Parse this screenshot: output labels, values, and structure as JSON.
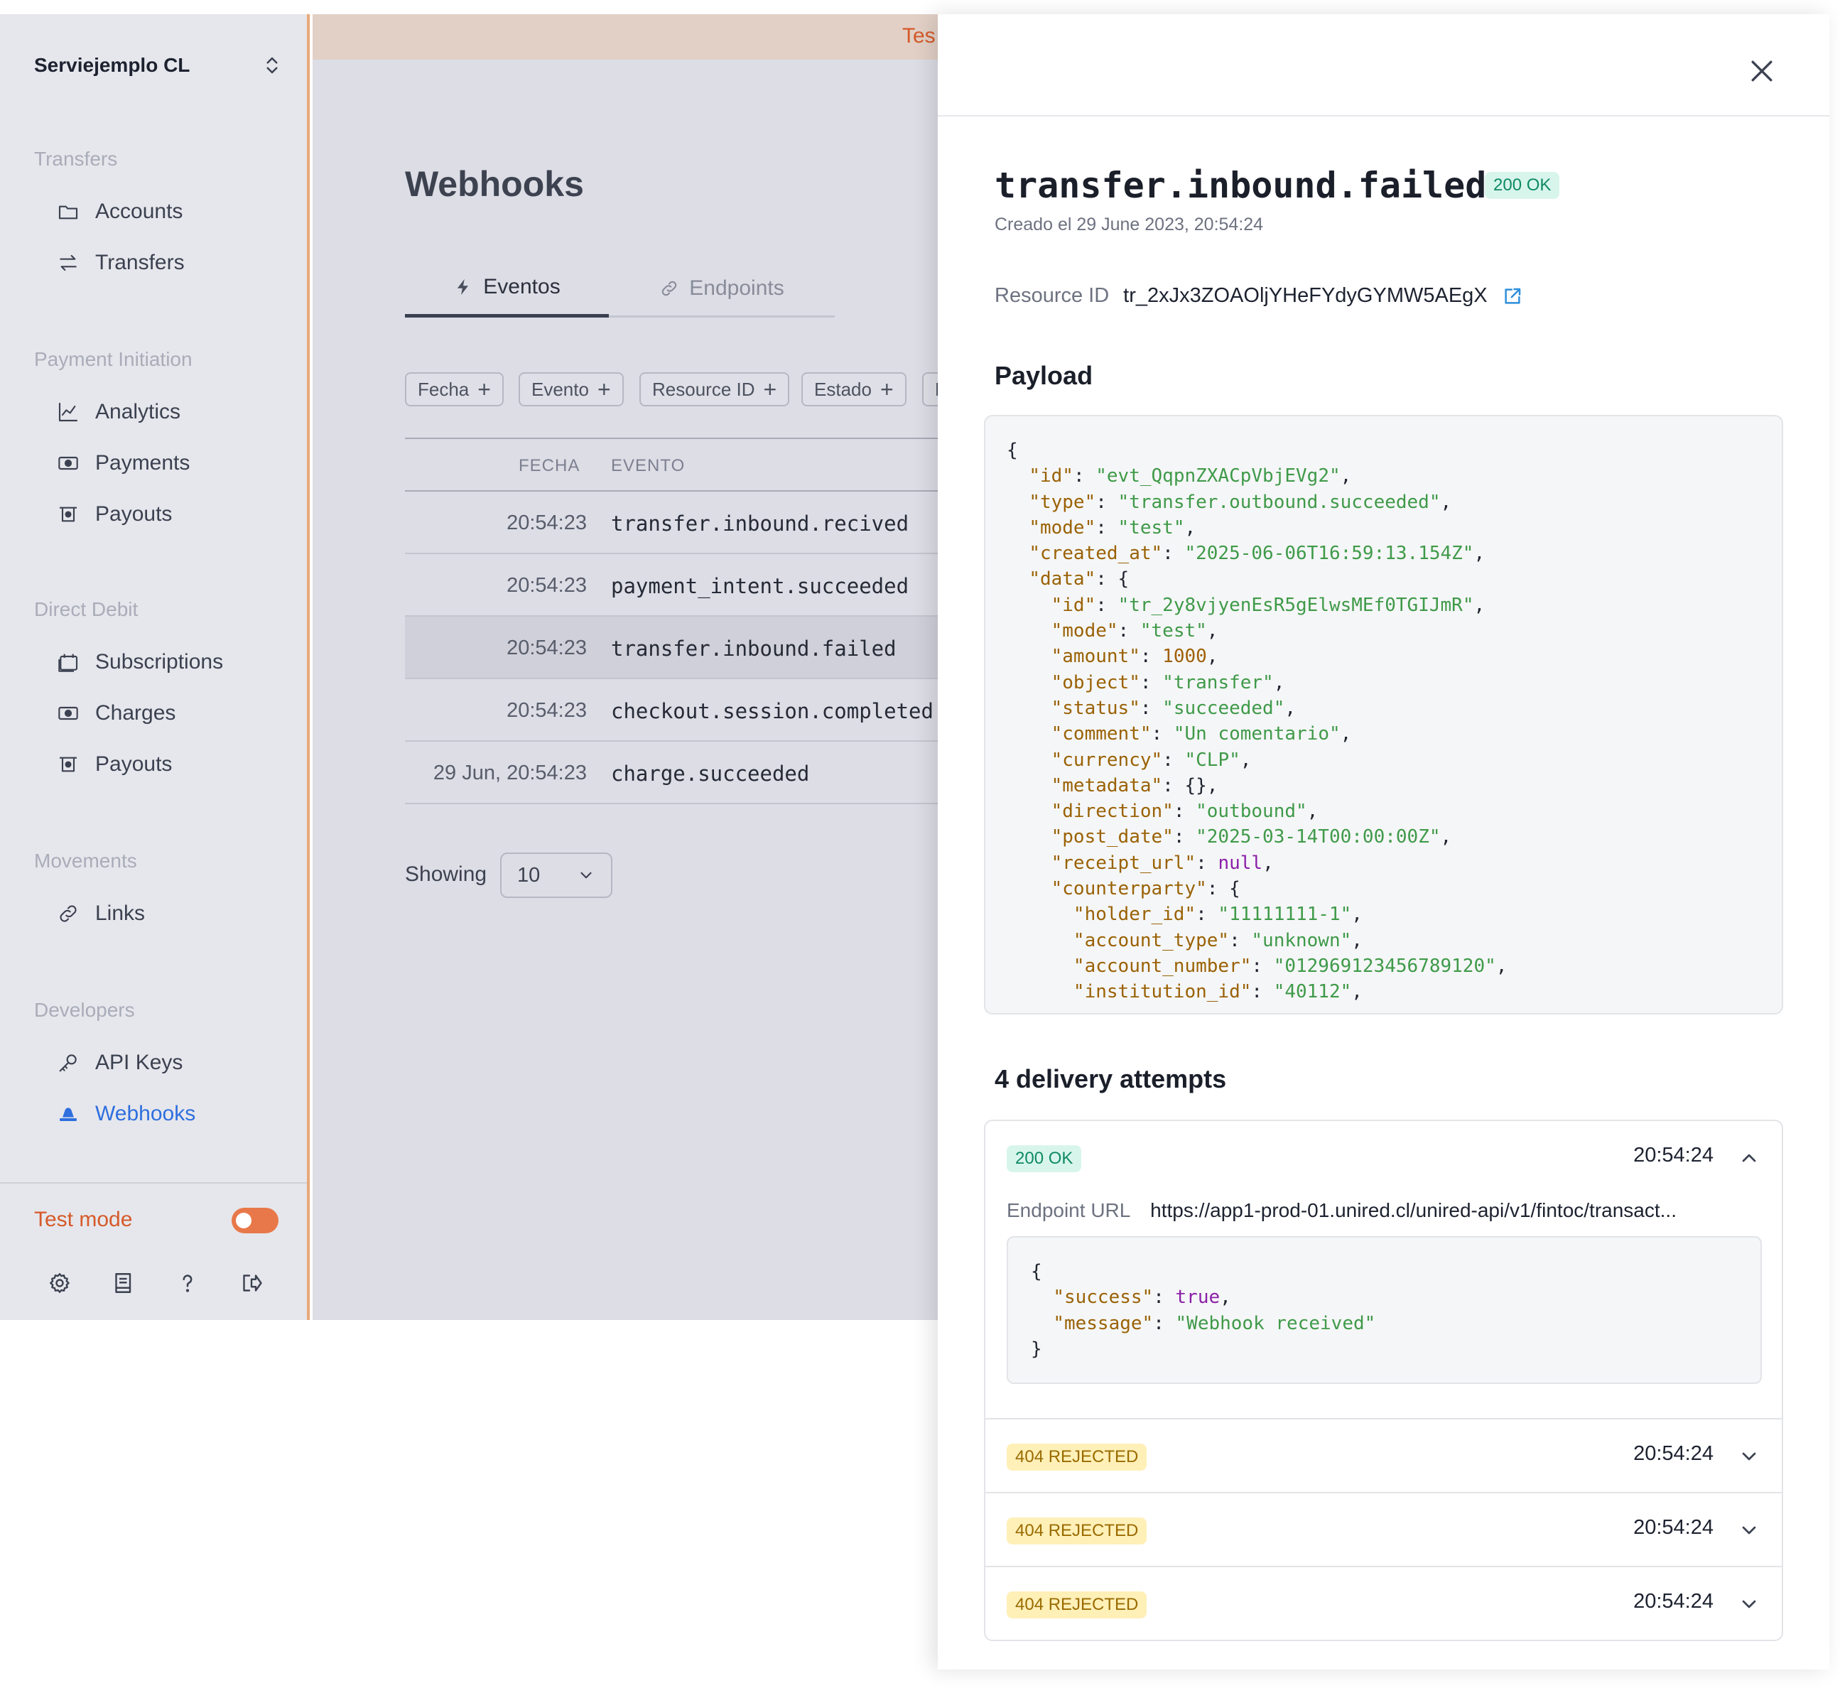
{
  "sidebar": {
    "org_name": "Serviejemplo CL",
    "sections": [
      {
        "title": "Transfers",
        "items": [
          {
            "label": "Accounts",
            "icon": "folder-icon"
          },
          {
            "label": "Transfers",
            "icon": "arrows-swap-icon"
          }
        ]
      },
      {
        "title": "Payment Initiation",
        "items": [
          {
            "label": "Analytics",
            "icon": "chart-line-icon"
          },
          {
            "label": "Payments",
            "icon": "cash-icon"
          },
          {
            "label": "Payouts",
            "icon": "payout-icon"
          }
        ]
      },
      {
        "title": "Direct Debit",
        "items": [
          {
            "label": "Subscriptions",
            "icon": "calendar-icon"
          },
          {
            "label": "Charges",
            "icon": "cash-icon"
          },
          {
            "label": "Payouts",
            "icon": "payout-icon"
          }
        ]
      },
      {
        "title": "Movements",
        "items": [
          {
            "label": "Links",
            "icon": "link-icon"
          }
        ]
      },
      {
        "title": "Developers",
        "items": [
          {
            "label": "API Keys",
            "icon": "key-icon"
          },
          {
            "label": "Webhooks",
            "icon": "webhook-icon",
            "active": true
          }
        ]
      }
    ],
    "test_mode_label": "Test mode",
    "test_mode_on": true,
    "footer_icons": [
      "settings-icon",
      "docs-icon",
      "help-icon",
      "logout-icon"
    ]
  },
  "banner": {
    "text": "Tes"
  },
  "main": {
    "title": "Webhooks",
    "tabs": [
      {
        "label": "Eventos",
        "icon": "bolt-icon",
        "active": true
      },
      {
        "label": "Endpoints",
        "icon": "link-icon",
        "active": false
      }
    ],
    "filters": [
      "Fecha",
      "Evento",
      "Resource ID",
      "Estado",
      "E"
    ],
    "table": {
      "headers": [
        "FECHA",
        "EVENTO"
      ],
      "rows": [
        {
          "date": "20:54:23",
          "event": "transfer.inbound.recived"
        },
        {
          "date": "20:54:23",
          "event": "payment_intent.succeeded"
        },
        {
          "date": "20:54:23",
          "event": "transfer.inbound.failed",
          "selected": true
        },
        {
          "date": "20:54:23",
          "event": "checkout.session.completed"
        },
        {
          "date": "29 Jun, 20:54:23",
          "event": "charge.succeeded"
        }
      ]
    },
    "showing_label": "Showing",
    "page_size": "10"
  },
  "drawer": {
    "event_type": "transfer.inbound.failed",
    "status_badge": "200 OK",
    "created_at": "Creado el 29 June 2023, 20:54:24",
    "resource_id_label": "Resource ID",
    "resource_id": "tr_2xJx3ZOAOljYHeFYdyGYMW5AEgX",
    "payload_title": "Payload",
    "payload_lines": [
      [
        [
          "p",
          "{"
        ]
      ],
      [
        [
          "p",
          "  "
        ],
        [
          "k",
          "\"id\""
        ],
        [
          "p",
          ": "
        ],
        [
          "s",
          "\"evt_QqpnZXACpVbjEVg2\""
        ],
        [
          "p",
          ","
        ]
      ],
      [
        [
          "p",
          "  "
        ],
        [
          "k",
          "\"type\""
        ],
        [
          "p",
          ": "
        ],
        [
          "s",
          "\"transfer.outbound.succeeded\""
        ],
        [
          "p",
          ","
        ]
      ],
      [
        [
          "p",
          "  "
        ],
        [
          "k",
          "\"mode\""
        ],
        [
          "p",
          ": "
        ],
        [
          "s",
          "\"test\""
        ],
        [
          "p",
          ","
        ]
      ],
      [
        [
          "p",
          "  "
        ],
        [
          "k",
          "\"created_at\""
        ],
        [
          "p",
          ": "
        ],
        [
          "s",
          "\"2025-06-06T16:59:13.154Z\""
        ],
        [
          "p",
          ","
        ]
      ],
      [
        [
          "p",
          "  "
        ],
        [
          "k",
          "\"data\""
        ],
        [
          "p",
          ": {"
        ]
      ],
      [
        [
          "p",
          "    "
        ],
        [
          "k",
          "\"id\""
        ],
        [
          "p",
          ": "
        ],
        [
          "s",
          "\"tr_2y8vjyenEsR5gElwsMEf0TGIJmR\""
        ],
        [
          "p",
          ","
        ]
      ],
      [
        [
          "p",
          "    "
        ],
        [
          "k",
          "\"mode\""
        ],
        [
          "p",
          ": "
        ],
        [
          "s",
          "\"test\""
        ],
        [
          "p",
          ","
        ]
      ],
      [
        [
          "p",
          "    "
        ],
        [
          "k",
          "\"amount\""
        ],
        [
          "p",
          ": "
        ],
        [
          "n",
          "1000"
        ],
        [
          "p",
          ","
        ]
      ],
      [
        [
          "p",
          "    "
        ],
        [
          "k",
          "\"object\""
        ],
        [
          "p",
          ": "
        ],
        [
          "s",
          "\"transfer\""
        ],
        [
          "p",
          ","
        ]
      ],
      [
        [
          "p",
          "    "
        ],
        [
          "k",
          "\"status\""
        ],
        [
          "p",
          ": "
        ],
        [
          "s",
          "\"succeeded\""
        ],
        [
          "p",
          ","
        ]
      ],
      [
        [
          "p",
          "    "
        ],
        [
          "k",
          "\"comment\""
        ],
        [
          "p",
          ": "
        ],
        [
          "s",
          "\"Un comentario\""
        ],
        [
          "p",
          ","
        ]
      ],
      [
        [
          "p",
          "    "
        ],
        [
          "k",
          "\"currency\""
        ],
        [
          "p",
          ": "
        ],
        [
          "s",
          "\"CLP\""
        ],
        [
          "p",
          ","
        ]
      ],
      [
        [
          "p",
          "    "
        ],
        [
          "k",
          "\"metadata\""
        ],
        [
          "p",
          ": {},"
        ]
      ],
      [
        [
          "p",
          "    "
        ],
        [
          "k",
          "\"direction\""
        ],
        [
          "p",
          ": "
        ],
        [
          "s",
          "\"outbound\""
        ],
        [
          "p",
          ","
        ]
      ],
      [
        [
          "p",
          "    "
        ],
        [
          "k",
          "\"post_date\""
        ],
        [
          "p",
          ": "
        ],
        [
          "s",
          "\"2025-03-14T00:00:00Z\""
        ],
        [
          "p",
          ","
        ]
      ],
      [
        [
          "p",
          "    "
        ],
        [
          "k",
          "\"receipt_url\""
        ],
        [
          "p",
          ": "
        ],
        [
          "l",
          "null"
        ],
        [
          "p",
          ","
        ]
      ],
      [
        [
          "p",
          "    "
        ],
        [
          "k",
          "\"counterparty\""
        ],
        [
          "p",
          ": {"
        ]
      ],
      [
        [
          "p",
          "      "
        ],
        [
          "k",
          "\"holder_id\""
        ],
        [
          "p",
          ": "
        ],
        [
          "s",
          "\"11111111-1\""
        ],
        [
          "p",
          ","
        ]
      ],
      [
        [
          "p",
          "      "
        ],
        [
          "k",
          "\"account_type\""
        ],
        [
          "p",
          ": "
        ],
        [
          "s",
          "\"unknown\""
        ],
        [
          "p",
          ","
        ]
      ],
      [
        [
          "p",
          "      "
        ],
        [
          "k",
          "\"account_number\""
        ],
        [
          "p",
          ": "
        ],
        [
          "s",
          "\"012969123456789120\""
        ],
        [
          "p",
          ","
        ]
      ],
      [
        [
          "p",
          "      "
        ],
        [
          "k",
          "\"institution_id\""
        ],
        [
          "p",
          ": "
        ],
        [
          "s",
          "\"40112\""
        ],
        [
          "p",
          ","
        ]
      ]
    ],
    "attempts_title": "4 delivery attempts",
    "attempts": [
      {
        "status": "200 OK",
        "kind": "ok",
        "time": "20:54:24",
        "expanded": true
      },
      {
        "status": "404 REJECTED",
        "kind": "rejected",
        "time": "20:54:24",
        "expanded": false
      },
      {
        "status": "404 REJECTED",
        "kind": "rejected",
        "time": "20:54:24",
        "expanded": false
      },
      {
        "status": "404 REJECTED",
        "kind": "rejected",
        "time": "20:54:24",
        "expanded": false
      }
    ],
    "endpoint_label": "Endpoint URL",
    "endpoint_url": "https://app1-prod-01.unired.cl/unired-api/v1/fintoc/transact...",
    "response_lines": [
      [
        [
          "p",
          "{"
        ]
      ],
      [
        [
          "p",
          "  "
        ],
        [
          "k",
          "\"success\""
        ],
        [
          "p",
          ": "
        ],
        [
          "l",
          "true"
        ],
        [
          "p",
          ","
        ]
      ],
      [
        [
          "p",
          "  "
        ],
        [
          "k",
          "\"message\""
        ],
        [
          "p",
          ": "
        ],
        [
          "s",
          "\"Webhook received\""
        ]
      ],
      [
        [
          "p",
          "}"
        ]
      ]
    ]
  }
}
